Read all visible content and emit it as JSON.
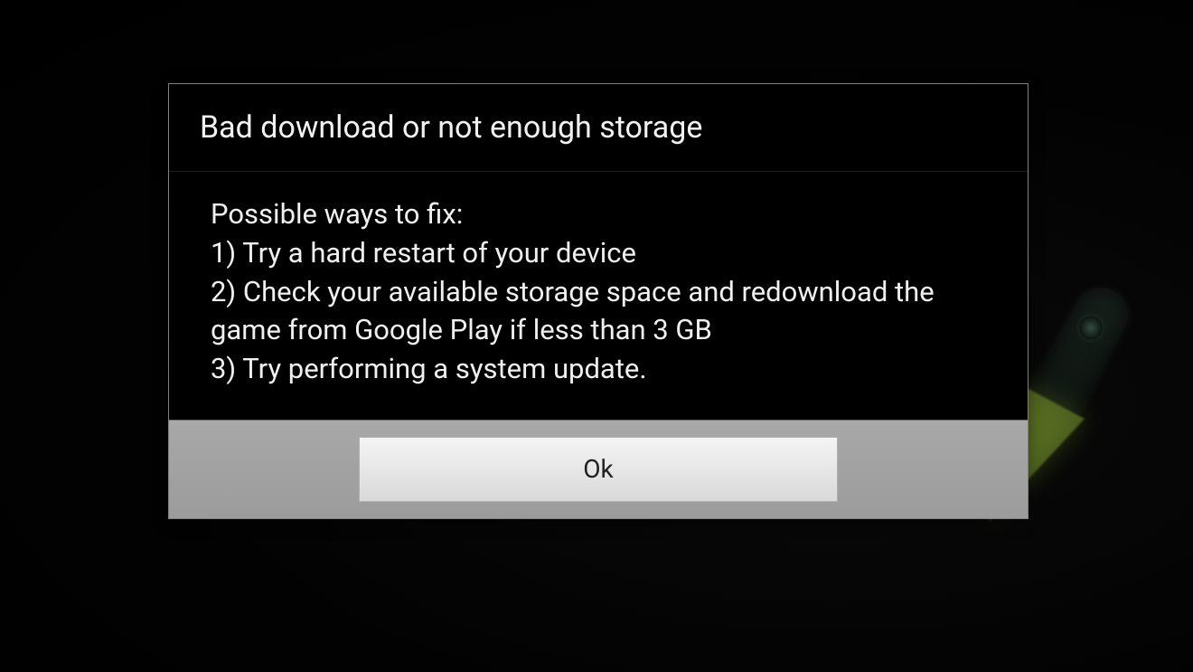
{
  "dialog": {
    "title": "Bad download or not enough storage",
    "body": {
      "intro": "Possible ways to fix:",
      "line1": "1) Try a hard restart of your device",
      "line2": "2) Check your available storage space and redownload the game from Google Play if less than 3 GB",
      "line3": "3) Try performing a system update."
    },
    "ok_label": "Ok"
  }
}
